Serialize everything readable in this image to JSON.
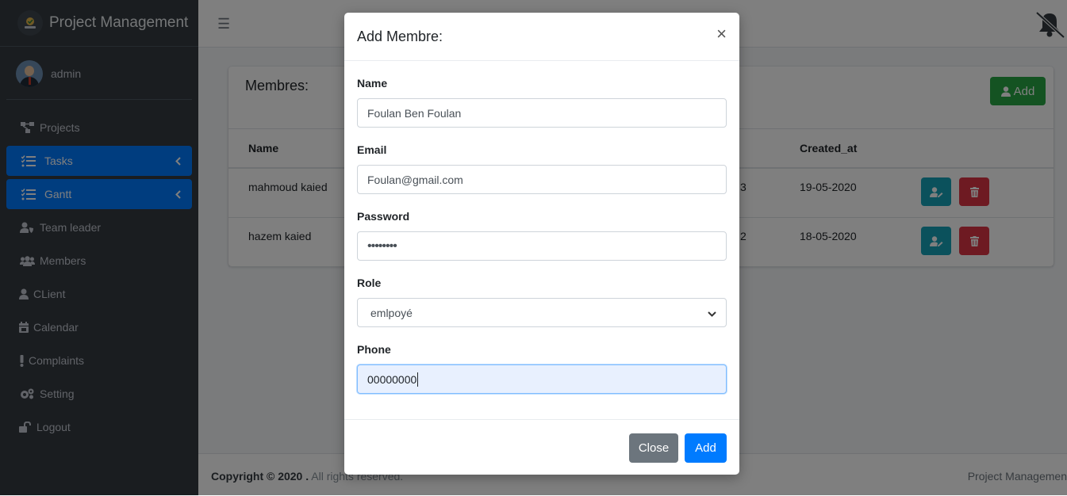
{
  "app": {
    "brand": "Project Management",
    "user": "admin"
  },
  "sidebar": {
    "items": [
      {
        "label": "Projects",
        "icon": "project-diagram-icon",
        "active": false
      },
      {
        "label": "Tasks",
        "icon": "tasks-icon",
        "active": true
      },
      {
        "label": "Gantt",
        "icon": "tasks-icon",
        "active": true
      },
      {
        "label": "Team leader",
        "icon": "user-shield-icon",
        "active": false
      },
      {
        "label": "Members",
        "icon": "users-icon",
        "active": false
      },
      {
        "label": "CLient",
        "icon": "user-icon",
        "active": false
      },
      {
        "label": "Calendar",
        "icon": "calendar-icon",
        "active": false
      },
      {
        "label": "Complaints",
        "icon": "exclamation-icon",
        "active": false
      },
      {
        "label": "Setting",
        "icon": "cogs-icon",
        "active": false
      },
      {
        "label": "Logout",
        "icon": "unlock-icon",
        "active": false
      }
    ]
  },
  "main": {
    "card_title": "Membres:",
    "add_label": "Add",
    "columns": [
      "Name",
      "Created_at"
    ],
    "rows": [
      {
        "name": "mahmoud kaied",
        "partial": "3",
        "created_at": "19-05-2020"
      },
      {
        "name": "hazem kaied",
        "partial": "2",
        "created_at": "18-05-2020"
      }
    ]
  },
  "footer": {
    "copyright": "Copyright © 2020 .",
    "rights": "All rights reserved.",
    "right_text": "Project Managemen"
  },
  "modal": {
    "title": "Add Membre:",
    "close_symbol": "×",
    "fields": {
      "name": {
        "label": "Name",
        "value": "Foulan Ben Foulan"
      },
      "email": {
        "label": "Email",
        "value": "Foulan@gmail.com"
      },
      "password": {
        "label": "Password",
        "value": "••••••••"
      },
      "role": {
        "label": "Role",
        "value": "emlpoyé"
      },
      "phone": {
        "label": "Phone",
        "value": "00000000"
      }
    },
    "close_label": "Close",
    "add_label": "Add"
  },
  "colors": {
    "primary": "#007bff",
    "success": "#28a745",
    "info": "#17a2b8",
    "danger": "#dc3545",
    "secondary": "#6c757d",
    "sidebar": "#343a40"
  }
}
